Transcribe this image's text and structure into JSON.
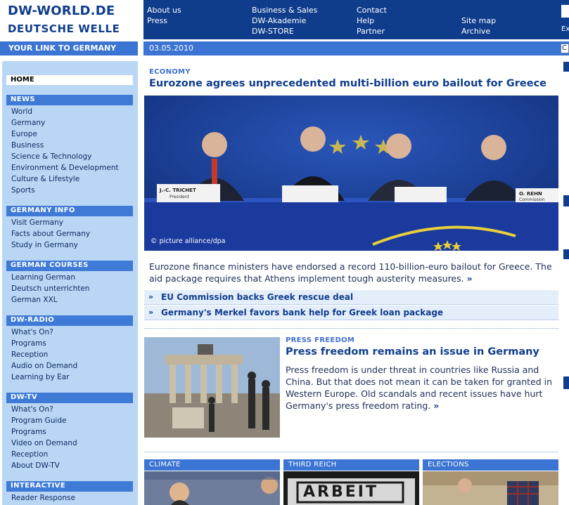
{
  "logo": {
    "line1": "DW-WORLD.DE",
    "line2": "DEUTSCHE WELLE"
  },
  "tagline": "YOUR LINK TO GERMANY",
  "topnav": {
    "col1": [
      "About us",
      "Press"
    ],
    "col2": [
      "Business & Sales",
      "DW-Akademie",
      "DW-STORE"
    ],
    "col3": [
      "Contact",
      "Help",
      "Partner"
    ],
    "col4": [
      "Site map",
      "Archive"
    ],
    "search_stub": "Ex"
  },
  "date": "03.05.2010",
  "date_input": "C",
  "sidebar": {
    "home": "HOME",
    "sections": [
      {
        "title": "NEWS",
        "items": [
          "World",
          "Germany",
          "Europe",
          "Business",
          "Science & Technology",
          "Environment & Development",
          "Culture & Lifestyle",
          "Sports"
        ]
      },
      {
        "title": "GERMANY INFO",
        "items": [
          "Visit Germany",
          "Facts about Germany",
          "Study in Germany"
        ]
      },
      {
        "title": "GERMAN COURSES",
        "items": [
          "Learning German",
          "Deutsch unterrichten",
          "German XXL"
        ]
      },
      {
        "title": "DW-RADIO",
        "items": [
          "What's On?",
          "Programs",
          "Reception",
          "Audio on Demand",
          "Learning by Ear"
        ]
      },
      {
        "title": "DW-TV",
        "items": [
          "What's On?",
          "Program Guide",
          "Programs",
          "Video on Demand",
          "Reception",
          "About DW-TV"
        ]
      },
      {
        "title": "INTERACTIVE",
        "items": [
          "Reader Response"
        ]
      }
    ]
  },
  "lead": {
    "kicker": "ECONOMY",
    "headline": "Eurozone agrees unprecedented multi-billion euro bailout for Greece",
    "photo_credit": "© picture alliance/dpa",
    "name_plates": [
      "J.-C. TRICHET",
      "O. REHN"
    ],
    "name_plate_subs": [
      "President",
      "Commission"
    ],
    "teaser": "Eurozone finance ministers have endorsed a record 110-billion-euro bailout for Greece. The aid package requires that Athens implement tough austerity measures.",
    "more": "»",
    "related": [
      "EU Commission backs Greek rescue deal",
      "Germany's Merkel favors bank help for Greek loan package"
    ],
    "related_arrow": "»"
  },
  "second": {
    "kicker": "PRESS FREEDOM",
    "headline": "Press freedom remains an issue in Germany",
    "teaser": "Press freedom is under threat in countries like Russia and China. But that does not mean it can be taken for granted in Western Europe. Old scandals and recent issues have hurt Germany's press freedom rating.",
    "more": "»"
  },
  "categories": [
    "CLIMATE",
    "THIRD REICH",
    "ELECTIONS"
  ],
  "arbeit_sign": "ARBEIT"
}
